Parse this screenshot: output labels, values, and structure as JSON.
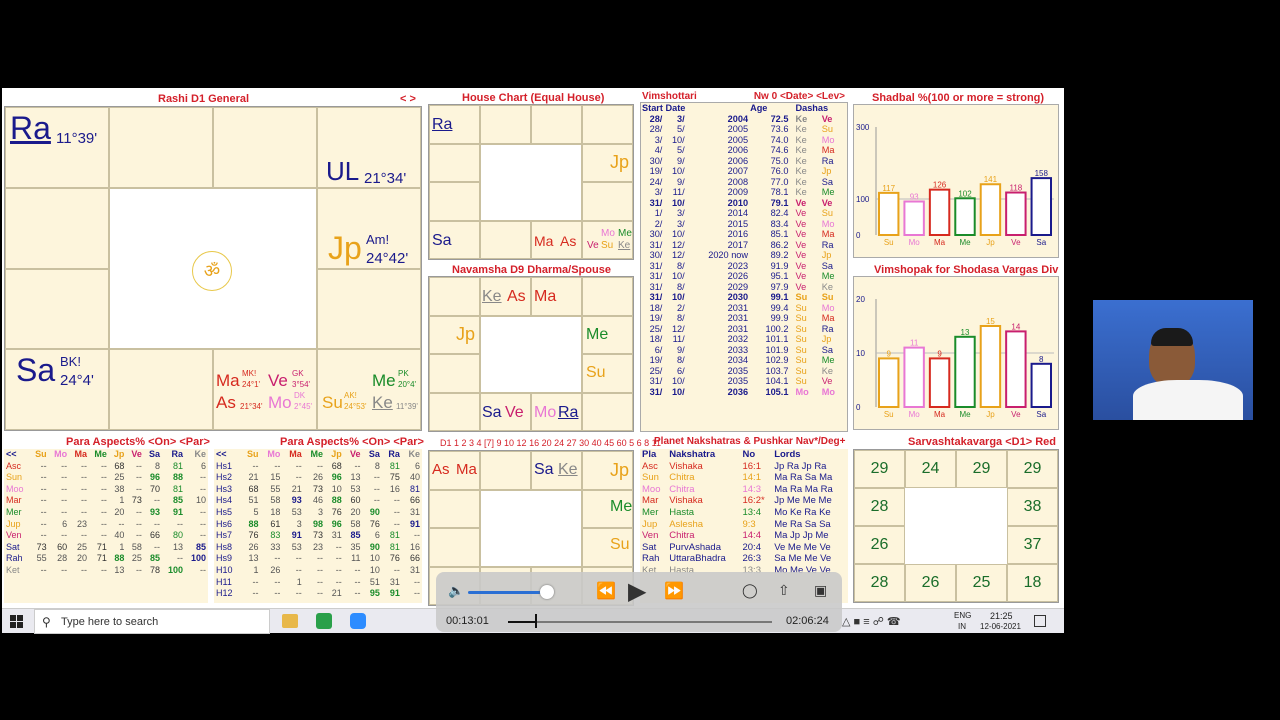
{
  "rashi": {
    "title": "Rashi D1 General",
    "nav": "< >",
    "ra": "Ra",
    "ra_deg": "11°39'",
    "ul": "UL",
    "ul_deg": "21°34'",
    "jp": "Jp",
    "jp_am": "Am!",
    "jp_deg": "24°42'",
    "sa": "Sa",
    "sa_bk": "BK!",
    "sa_deg": "24°4'",
    "om": "ॐ",
    "ma": "Ma",
    "ma_sup": "MK!",
    "ma_deg": "24°1'",
    "ve": "Ve",
    "ve_sup": "GK",
    "ve_deg": "3°54'",
    "as": "As",
    "as_deg": "21°34'",
    "mo": "Mo",
    "mo_sup": "DK",
    "mo_deg": "2°45'",
    "su": "Su",
    "su_sup": "AK!",
    "su_deg": "24°53'",
    "ke": "Ke",
    "ke_deg": "11°39'",
    "me": "Me",
    "me_sup": "PK",
    "me_deg": "20°4'"
  },
  "house": {
    "title": "House Chart (Equal House)",
    "ra": "Ra",
    "jp": "Jp",
    "sa": "Sa",
    "ma": "Ma",
    "as": "As",
    "mo": "Mo",
    "me": "Me",
    "ve": "Ve",
    "su": "Su",
    "ke": "Ke"
  },
  "navamsha": {
    "title": "Navamsha D9 Dharma/Spouse",
    "ke": "Ke",
    "as": "As",
    "ma": "Ma",
    "jp": "Jp",
    "me": "Me",
    "su": "Su",
    "sa": "Sa",
    "ve": "Ve",
    "mo": "Mo",
    "ra": "Ra"
  },
  "d1strip": {
    "title": "D1 1 2 3 4 [7] 9 10 12 16 20 24 27 30 40 45 60 5 6 8 11",
    "as": "As",
    "ma": "Ma",
    "sa": "Sa",
    "ke": "Ke",
    "jp": "Jp",
    "me": "Me",
    "su": "Su"
  },
  "dasha": {
    "title": "Vimshottari",
    "right": "Nw 0 <Date> <Lev>",
    "h_start": "Start Date",
    "h_age": "Age",
    "h_dashas": "Dashas",
    "rows": [
      [
        "28/",
        "3/",
        "2004",
        "72.5",
        "Ke",
        "Ve"
      ],
      [
        "28/",
        "5/",
        "2005",
        "73.6",
        "Ke",
        "Su"
      ],
      [
        "3/",
        "10/",
        "2005",
        "74.0",
        "Ke",
        "Mo"
      ],
      [
        "4/",
        "5/",
        "2006",
        "74.6",
        "Ke",
        "Ma"
      ],
      [
        "30/",
        "9/",
        "2006",
        "75.0",
        "Ke",
        "Ra"
      ],
      [
        "19/",
        "10/",
        "2007",
        "76.0",
        "Ke",
        "Jp"
      ],
      [
        "24/",
        "9/",
        "2008",
        "77.0",
        "Ke",
        "Sa"
      ],
      [
        "3/",
        "11/",
        "2009",
        "78.1",
        "Ke",
        "Me"
      ],
      [
        "31/",
        "10/",
        "2010",
        "79.1",
        "Ve",
        "Ve"
      ],
      [
        "1/",
        "3/",
        "2014",
        "82.4",
        "Ve",
        "Su"
      ],
      [
        "2/",
        "3/",
        "2015",
        "83.4",
        "Ve",
        "Mo"
      ],
      [
        "30/",
        "10/",
        "2016",
        "85.1",
        "Ve",
        "Ma"
      ],
      [
        "31/",
        "12/",
        "2017",
        "86.2",
        "Ve",
        "Ra"
      ],
      [
        "30/",
        "12/",
        "2020 now",
        "89.2",
        "Ve",
        "Jp"
      ],
      [
        "31/",
        "8/",
        "2023",
        "91.9",
        "Ve",
        "Sa"
      ],
      [
        "31/",
        "10/",
        "2026",
        "95.1",
        "Ve",
        "Me"
      ],
      [
        "31/",
        "8/",
        "2029",
        "97.9",
        "Ve",
        "Ke"
      ],
      [
        "31/",
        "10/",
        "2030",
        "99.1",
        "Su",
        "Su"
      ],
      [
        "18/",
        "2/",
        "2031",
        "99.4",
        "Su",
        "Mo"
      ],
      [
        "19/",
        "8/",
        "2031",
        "99.9",
        "Su",
        "Ma"
      ],
      [
        "25/",
        "12/",
        "2031",
        "100.2",
        "Su",
        "Ra"
      ],
      [
        "18/",
        "11/",
        "2032",
        "101.1",
        "Su",
        "Jp"
      ],
      [
        "6/",
        "9/",
        "2033",
        "101.9",
        "Su",
        "Sa"
      ],
      [
        "19/",
        "8/",
        "2034",
        "102.9",
        "Su",
        "Me"
      ],
      [
        "25/",
        "6/",
        "2035",
        "103.7",
        "Su",
        "Ke"
      ],
      [
        "31/",
        "10/",
        "2035",
        "104.1",
        "Su",
        "Ve"
      ],
      [
        "31/",
        "10/",
        "2036",
        "105.1",
        "Mo",
        "Mo"
      ]
    ]
  },
  "shadbal": {
    "title": "Shadbal %(100 or more = strong)",
    "ylabels": [
      "300",
      "100",
      "0"
    ],
    "vals": [
      "117",
      "93",
      "126",
      "102",
      "141",
      "118",
      "158"
    ],
    "cats": [
      "Su",
      "Mo",
      "Ma",
      "Me",
      "Jp",
      "Ve",
      "Sa"
    ]
  },
  "vimshopak": {
    "title": "Vimshopak for Shodasa Vargas Div",
    "ylabels": [
      "20",
      "10",
      "0"
    ],
    "vals": [
      "9",
      "11",
      "9",
      "13",
      "15",
      "14",
      "8"
    ],
    "cats": [
      "Su",
      "Mo",
      "Ma",
      "Me",
      "Jp",
      "Ve",
      "Sa"
    ]
  },
  "para1": {
    "title": "Para Aspects% <On> <Par>",
    "hdr": [
      "<<",
      "Su",
      "Mo",
      "Ma",
      "Me",
      "Jp",
      "Ve",
      "Sa",
      "Ra",
      "Ke"
    ],
    "rows": [
      [
        "Asc",
        "--",
        "--",
        "--",
        "--",
        "68",
        "--",
        "8",
        "81",
        "6"
      ],
      [
        "Sun",
        "--",
        "--",
        "--",
        "--",
        "25",
        "--",
        "96",
        "88",
        "--"
      ],
      [
        "Moo",
        "--",
        "--",
        "--",
        "--",
        "38",
        "--",
        "70",
        "81",
        "--"
      ],
      [
        "Mar",
        "--",
        "--",
        "--",
        "--",
        "1",
        "73",
        "--",
        "85",
        "10"
      ],
      [
        "Mer",
        "--",
        "--",
        "--",
        "--",
        "20",
        "--",
        "93",
        "91",
        "--"
      ],
      [
        "Jup",
        "--",
        "6",
        "23",
        "--",
        "--",
        "--",
        "--",
        "--",
        "--"
      ],
      [
        "Ven",
        "--",
        "--",
        "--",
        "--",
        "40",
        "--",
        "66",
        "80",
        "--"
      ],
      [
        "Sat",
        "73",
        "60",
        "25",
        "71",
        "1",
        "58",
        "--",
        "13",
        "85"
      ],
      [
        "Rah",
        "55",
        "28",
        "20",
        "71",
        "88",
        "25",
        "85",
        "--",
        "100"
      ],
      [
        "Ket",
        "--",
        "--",
        "--",
        "--",
        "13",
        "--",
        "78",
        "100",
        "--"
      ]
    ]
  },
  "para2": {
    "title": "Para Aspects% <On> <Par>",
    "hdr": [
      "<<",
      "Su",
      "Mo",
      "Ma",
      "Me",
      "Jp",
      "Ve",
      "Sa",
      "Ra",
      "Ke"
    ],
    "rows": [
      [
        "Hs1",
        "--",
        "--",
        "--",
        "--",
        "68",
        "--",
        "8",
        "81",
        "6"
      ],
      [
        "Hs2",
        "21",
        "15",
        "--",
        "26",
        "96",
        "13",
        "--",
        "75",
        "40"
      ],
      [
        "Hs3",
        "68",
        "55",
        "21",
        "73",
        "10",
        "53",
        "--",
        "16",
        "81"
      ],
      [
        "Hs4",
        "51",
        "58",
        "93",
        "46",
        "88",
        "60",
        "--",
        "--",
        "66"
      ],
      [
        "Hs5",
        "5",
        "18",
        "53",
        "3",
        "76",
        "20",
        "90",
        "--",
        "31"
      ],
      [
        "Hs6",
        "88",
        "61",
        "3",
        "98",
        "96",
        "58",
        "76",
        "--",
        "91"
      ],
      [
        "Hs7",
        "76",
        "83",
        "91",
        "73",
        "31",
        "85",
        "6",
        "81",
        "--"
      ],
      [
        "Hs8",
        "26",
        "33",
        "53",
        "23",
        "--",
        "35",
        "90",
        "81",
        "16"
      ],
      [
        "Hs9",
        "13",
        "--",
        "--",
        "--",
        "--",
        "11",
        "10",
        "76",
        "66"
      ],
      [
        "H10",
        "1",
        "26",
        "--",
        "--",
        "--",
        "--",
        "10",
        "--",
        "31"
      ],
      [
        "H11",
        "--",
        "--",
        "1",
        "--",
        "--",
        "--",
        "51",
        "31",
        "--"
      ],
      [
        "H12",
        "--",
        "--",
        "--",
        "--",
        "21",
        "--",
        "95",
        "91",
        "--"
      ]
    ]
  },
  "nak": {
    "title": "Planet Nakshatras & Pushkar Nav*/Deg+",
    "hdr": [
      "Pla",
      "Nakshatra",
      "No",
      "Lords"
    ],
    "rows": [
      [
        "Asc",
        "Vishaka",
        "16:1",
        "Jp Ra Jp Ra"
      ],
      [
        "Sun",
        "Chitra",
        "14:1",
        "Ma Ra Sa Ma"
      ],
      [
        "Moo",
        "Chitra",
        "14:3",
        "Ma Ra Ma Ra"
      ],
      [
        "Mar",
        "Vishaka",
        "16:2*",
        "Jp Me Me Me"
      ],
      [
        "Mer",
        "Hasta",
        "13:4",
        "Mo Ke Ra Ke"
      ],
      [
        "Jup",
        "Aslesha",
        "9:3",
        "Me Ra Sa Sa"
      ],
      [
        "Ven",
        "Chitra",
        "14:4",
        "Ma Jp Jp Me"
      ],
      [
        "Sat",
        "PurvAshada",
        "20:4",
        "Ve Me Me Ve"
      ],
      [
        "Rah",
        "UttaraBhadra",
        "26:3",
        "Sa Me Me Ve"
      ],
      [
        "Ket",
        "Hasta",
        "13:3",
        "Mo Me Ve Ve"
      ]
    ]
  },
  "sav": {
    "title": "Sarvashtakavarga <D1> Red",
    "nums": [
      "29",
      "24",
      "29",
      "29",
      "28",
      "",
      "",
      "38",
      "26",
      "",
      "",
      "37",
      "28",
      "26",
      "25",
      "18"
    ]
  },
  "video": {
    "current": "00:13:01",
    "total": "02:06:24"
  },
  "taskbar": {
    "search": "Type here to search",
    "lang1": "ENG",
    "lang2": "IN",
    "time": "21:25",
    "date": "12-06-2021"
  }
}
